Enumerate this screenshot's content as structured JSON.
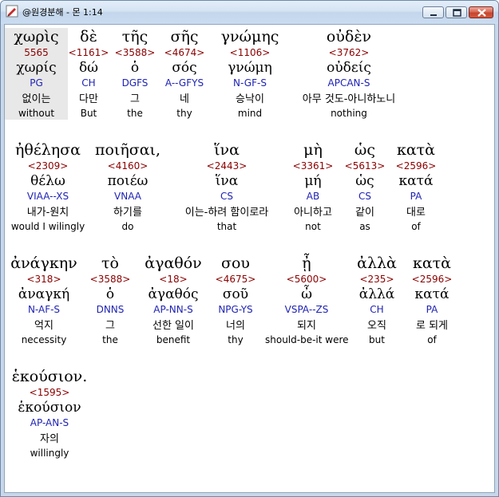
{
  "window": {
    "title": "@원경분해 - 몬 1:14"
  },
  "lines": [
    {
      "words": [
        {
          "greek": "χωρὶς",
          "strong": "5565",
          "lemma": "χωρίς",
          "parsing": "PG",
          "korean": "없이는",
          "english": "without"
        },
        {
          "greek": "δὲ",
          "strong": "<1161>",
          "lemma": "δώ",
          "parsing": "CH",
          "korean": "다만",
          "english": "But"
        },
        {
          "greek": "τῆς",
          "strong": "<3588>",
          "lemma": "ὁ",
          "parsing": "DGFS",
          "korean": "그",
          "english": "the"
        },
        {
          "greek": "σῆς",
          "strong": "<4674>",
          "lemma": "σός",
          "parsing": "A--GFYS",
          "korean": "네",
          "english": "thy"
        },
        {
          "greek": "γνώμης",
          "strong": "<1106>",
          "lemma": "γνώμη",
          "parsing": "N-GF-S",
          "korean": "승낙이",
          "english": "mind"
        },
        {
          "greek": "οὐδὲν",
          "strong": "<3762>",
          "lemma": "οὐδείς",
          "parsing": "APCAN-S",
          "korean": "아무 것도-아니하노니",
          "english": "nothing"
        }
      ]
    },
    {
      "words": [
        {
          "greek": "ἠθέλησα",
          "strong": "<2309>",
          "lemma": "θέλω",
          "parsing": "VIAA--XS",
          "korean": "내가-원치",
          "english": "would I wilingly"
        },
        {
          "greek": "ποιῆσαι,",
          "strong": "<4160>",
          "lemma": "ποιέω",
          "parsing": "VNAA",
          "korean": "하기를",
          "english": "do"
        },
        {
          "greek": "ἵνα",
          "strong": "<2443>",
          "lemma": "ἵνα",
          "parsing": "CS",
          "korean": "이는-하려 함이로라",
          "english": "that"
        },
        {
          "greek": "μὴ",
          "strong": "<3361>",
          "lemma": "μή",
          "parsing": "AB",
          "korean": "아니하고",
          "english": "not"
        },
        {
          "greek": "ὡς",
          "strong": "<5613>",
          "lemma": "ὡς",
          "parsing": "CS",
          "korean": "같이",
          "english": "as"
        },
        {
          "greek": "κατὰ",
          "strong": "<2596>",
          "lemma": "κατά",
          "parsing": "PA",
          "korean": "대로",
          "english": "of"
        }
      ]
    },
    {
      "words": [
        {
          "greek": "ἀνάγκην",
          "strong": "<318>",
          "lemma": "ἀναγκή",
          "parsing": "N-AF-S",
          "korean": "억지",
          "english": "necessity"
        },
        {
          "greek": "τὸ",
          "strong": "<3588>",
          "lemma": "ὁ",
          "parsing": "DNNS",
          "korean": "그",
          "english": "the"
        },
        {
          "greek": "ἀγαθόν",
          "strong": "<18>",
          "lemma": "ἀγαθός",
          "parsing": "AP-NN-S",
          "korean": "선한 일이",
          "english": "benefit"
        },
        {
          "greek": "σου",
          "strong": "<4675>",
          "lemma": "σοῦ",
          "parsing": "NPG-YS",
          "korean": "너의",
          "english": "thy"
        },
        {
          "greek": "ᾖ",
          "strong": "<5600>",
          "lemma": "ὦ",
          "parsing": "VSPA--ZS",
          "korean": "되지",
          "english": "should-be-it were"
        },
        {
          "greek": "ἀλλὰ",
          "strong": "<235>",
          "lemma": "ἀλλά",
          "parsing": "CH",
          "korean": "오직",
          "english": "but"
        },
        {
          "greek": "κατὰ",
          "strong": "<2596>",
          "lemma": "κατά",
          "parsing": "PA",
          "korean": "로 되게",
          "english": "of"
        }
      ]
    },
    {
      "words": [
        {
          "greek": "ἑκούσιον.",
          "strong": "<1595>",
          "lemma": "ἑκούσιον",
          "parsing": "AP-AN-S",
          "korean": "자의",
          "english": "willingly"
        }
      ]
    }
  ]
}
